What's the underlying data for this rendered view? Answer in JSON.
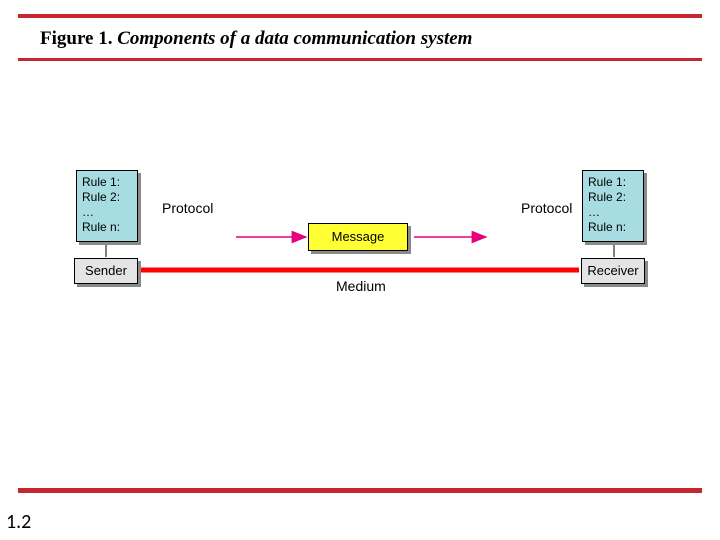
{
  "title": {
    "prefix": "Figure 1.",
    "rest": " Components of a data communication system"
  },
  "page_number": "1.2",
  "protocol_rules": {
    "r1": "Rule 1:",
    "r2": "Rule 2:",
    "dots": "…",
    "rn": "Rule n:"
  },
  "labels": {
    "protocol": "Protocol",
    "message": "Message",
    "medium": "Medium",
    "sender": "Sender",
    "receiver": "Receiver"
  }
}
